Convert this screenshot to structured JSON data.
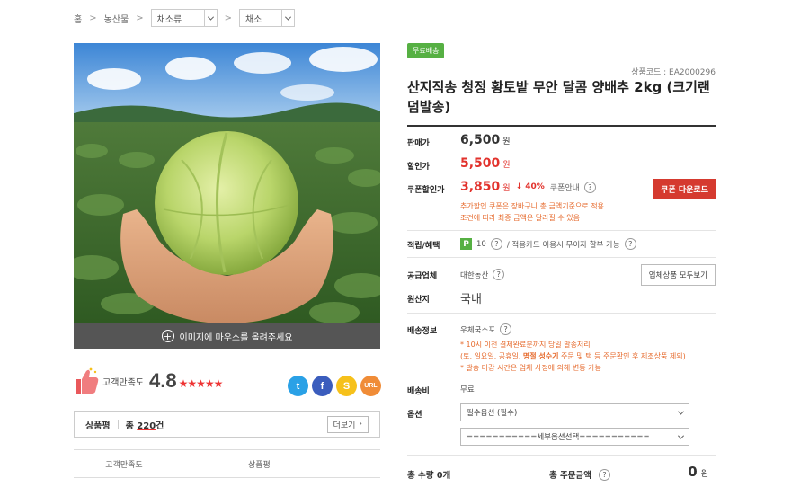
{
  "breadcrumb": {
    "home": "홈",
    "level1": "농산물",
    "level2_selected": "채소류",
    "level3_selected": "채소"
  },
  "image": {
    "hover_text": "이미지에 마우스를 올려주세요"
  },
  "satisfaction": {
    "label": "고객만족도",
    "score": "4.8",
    "stars": "★★★★★"
  },
  "share": {
    "twitter": "t",
    "facebook": "f",
    "kakaostory": "S",
    "url": "URL"
  },
  "reviews": {
    "title": "상품평",
    "count_prefix": "총",
    "count": "220",
    "count_suffix": "건",
    "more_label": "더보기",
    "col_satisfaction": "고객만족도",
    "col_review": "상품평"
  },
  "product": {
    "free_shipping_badge": "무료배송",
    "code": "상품코드 : EA2000296",
    "title": "산지직송 청정 황토밭 무안 달콤 양배추 2kg (크기랜덤발송)"
  },
  "pricing": {
    "list_label": "판매가",
    "list_price": "6,500",
    "sale_label": "할인가",
    "sale_price": "5,500",
    "coupon_label": "쿠폰할인가",
    "coupon_price": "3,850",
    "won": "원",
    "discount": "↓ 40%",
    "coupon_info": "쿠폰안내",
    "coupon_download": "쿠폰 다운로드",
    "coupon_note_1": "추가할인 쿠폰은 장바구니 총 금액기준으로 적용",
    "coupon_note_2": "조건에 따라 최종 금액은 달라질 수 있음"
  },
  "benefits": {
    "label": "적립/혜택",
    "points_badge": "P",
    "points": "10",
    "card_text": "/ 적용카드 이용시 무이자 할부 가능"
  },
  "supplier": {
    "label": "공급업체",
    "name": "대한농산",
    "view_all": "업체상품 모두보기"
  },
  "origin": {
    "label": "원산지",
    "value": "국내"
  },
  "shipping": {
    "label": "배송정보",
    "method": "우체국소포",
    "note_1": "* 10시 이전 결제완료분까지 당일 발송처리",
    "note_2_pre": "(토, 일요일, 공휴일, ",
    "note_2_bold": "명절 성수기",
    "note_2_post": " 주문 및 택 등 주문확인 후 제조상품 제외)",
    "note_3": "* 발송 마감 시간은 업체 사정에 의해 변동 가능",
    "fee_label": "배송비",
    "fee": "무료"
  },
  "options": {
    "label": "옵션",
    "required": "필수옵션 (필수)",
    "detail": "===========세부옵션선택==========="
  },
  "totals": {
    "qty_label": "총 수량 0개",
    "amount_label": "총 주문금액",
    "amount": "0",
    "won": "원"
  },
  "colors": {
    "accent_red": "#e2322c",
    "green_badge": "#56b043",
    "coupon_button": "#d53a2f",
    "note_orange": "#e66a2c"
  }
}
